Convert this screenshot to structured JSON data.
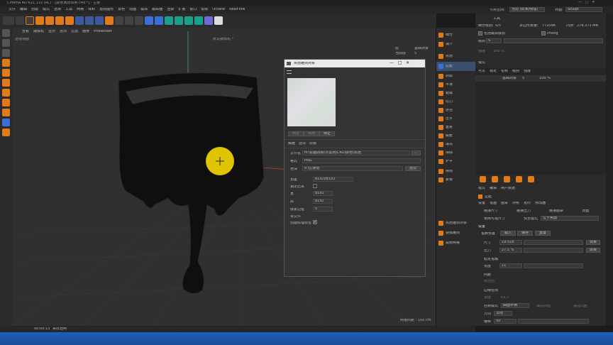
{
  "app": {
    "title": "Cinema 4D R21.115 (RC) - [颜色滴状效果.c4d *] - 主要",
    "menu": [
      "文件",
      "编辑",
      "创建",
      "模式",
      "选择",
      "工具",
      "网格",
      "体积",
      "运动图形",
      "角色",
      "动画",
      "模拟",
      "跟踪器",
      "渲染",
      "扩展",
      "窗口",
      "帮助",
      "Octane",
      "RealFlow"
    ],
    "layout_label": "界面:",
    "layout_value": "Sculpt",
    "node_label": "节点空间:",
    "node_value": "当前 (标准/物理)"
  },
  "viewport": {
    "menu": [
      "查看",
      "摄像机",
      "显示",
      "选项",
      "过滤",
      "面板",
      "ProRender"
    ],
    "name": "透视视图",
    "camera": "默认摄像机 *",
    "stats_labels": [
      "层",
      "当前层"
    ],
    "stats_values": [
      "基础对象",
      "5"
    ],
    "grid_spacing": "网格间距 : 100 cm"
  },
  "dialog": {
    "title": "烘焙雕刻对象",
    "preview_buttons": [
      "预览",
      "烘焙",
      "停止"
    ],
    "tabs": [
      "烘焙",
      "选项",
      "层级"
    ],
    "filename_label": "文件名",
    "filename_value": "M:\\动画视频\\学案例\\C4D\\颜色\\烘焙",
    "filename_btn": "...",
    "format_label": "格式",
    "format_value": "PNG",
    "depth_label": "色深",
    "depth_value": "8 位/通道",
    "options_btn": "选项",
    "preset_label": "预置",
    "preset_value": "8192x8192",
    "lock_label": "锁定比率",
    "width_label": "宽",
    "width_value": "8192",
    "height_label": "高",
    "height_value": "8192",
    "pixel_label": "像素边框",
    "pixel_value": "5",
    "single_label": "单文件",
    "create_label": "创建纹理标签"
  },
  "sculpt_tools": [
    "细分",
    "减少",
    "烘焙",
    "拉起",
    "抓取",
    "平滑",
    "蜡模",
    "切刀",
    "挤捏",
    "压平",
    "重复",
    "膨胀",
    "填充",
    "擦除",
    "铲平",
    "擦除",
    "蒙板"
  ],
  "sculpt_bottom": [
    "烘焙雕刻对象",
    "镜像雕刻",
    "投射网格"
  ],
  "attributes": {
    "top_label": "工具",
    "subdiv_label": "细分级别:",
    "subdiv_value": "5/5",
    "poly_label": "多边形数量:",
    "poly_value": "772096",
    "mem_label": "内存:",
    "mem_value": "278.373 MB",
    "checkbox1": "包括最高级别",
    "checkbox2": "Phong",
    "level_label": "级别",
    "level_value": "5",
    "strength_label": "强度",
    "strength_value": "100 %",
    "mode_label": "模式"
  },
  "layers": {
    "headers": [
      "可见",
      "锁定",
      "名称",
      "级别",
      "强度"
    ],
    "row": {
      "name": "基础对象",
      "level": "5",
      "strength": "100 %"
    }
  },
  "brush_panel": {
    "menu": [
      "模式",
      "编辑",
      "用户数据"
    ],
    "title": "拉起",
    "tabs": [
      "设置",
      "笔画",
      "图章",
      "对称",
      "拓印",
      "修改器"
    ],
    "check_labels": [
      "链接尺寸",
      "链接压力",
      "链接图章",
      "背面"
    ],
    "preview_label": "使用可视尺寸",
    "preview_mode": "预览模式",
    "preview_value": "位于焦面",
    "section": "设置",
    "preset_label": "笔刷预置",
    "preset_buttons": [
      "载入",
      "保存",
      "重置"
    ],
    "size_label": "尺寸",
    "size_value": "19.516",
    "pressure_label": "压力",
    "pressure_value": "27.1 %",
    "effect_btn": "效果",
    "stroke_label": "稳定笔触",
    "length_label": "长度",
    "length_value": "11",
    "spacing_label": "间距",
    "spacing_sub": "百分比",
    "edge_label": "边缘检测",
    "angle_label": "角度",
    "angle_value": "63.7",
    "ctrl_label": "控制模式",
    "ctrl_value": "曲面手柄",
    "fill_label": "填充凹陷",
    "fill_label2": "填充凸起",
    "dir_label": "方向",
    "dir_value": "法线",
    "offset_label": "偏移",
    "offset_value": "50"
  },
  "timeline": {
    "time": "00:00:13",
    "status": "采样透明"
  },
  "colors": {
    "accent": "#f5d800",
    "orange": "#e07a1a",
    "blue_btn": "#3a6fd8",
    "teal": "#1aa08a"
  }
}
